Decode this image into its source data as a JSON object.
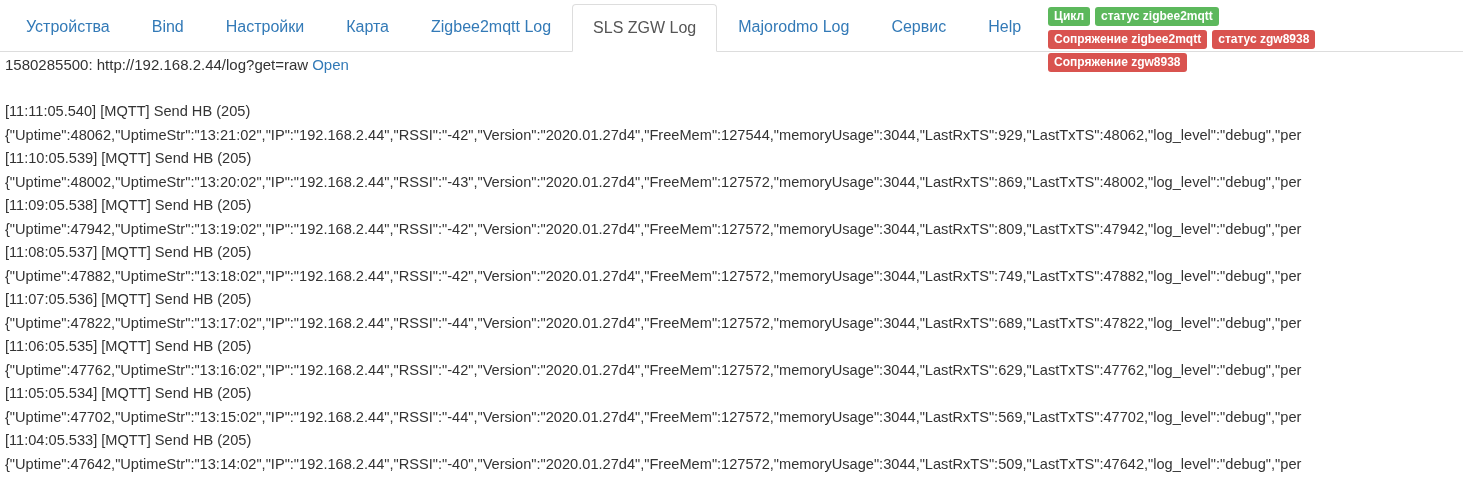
{
  "tabs": [
    {
      "label": "Устройства",
      "selected": false
    },
    {
      "label": "Bind",
      "selected": false
    },
    {
      "label": "Настройки",
      "selected": false
    },
    {
      "label": "Карта",
      "selected": false
    },
    {
      "label": "Zigbee2mqtt Log",
      "selected": false
    },
    {
      "label": "SLS ZGW Log",
      "selected": true
    },
    {
      "label": "Majorodmo Log",
      "selected": false
    },
    {
      "label": "Сервис",
      "selected": false
    },
    {
      "label": "Help",
      "selected": false
    }
  ],
  "status_badges": [
    {
      "label": "Цикл",
      "color": "#5cb85c"
    },
    {
      "label": "статус zigbee2mqtt",
      "color": "#5cb85c"
    },
    {
      "label": "Сопряжение zigbee2mqtt",
      "color": "#d9534f"
    },
    {
      "label": "статус zgw8938",
      "color": "#d9534f"
    },
    {
      "label": "Сопряжение zgw8938",
      "color": "#d9534f"
    }
  ],
  "source": {
    "text": "1580285500: http://192.168.2.44/log?get=raw",
    "link": "Open"
  },
  "log_lines": [
    "[11:11:05.540] [MQTT] Send HB (205)",
    "{\"Uptime\":48062,\"UptimeStr\":\"13:21:02\",\"IP\":\"192.168.2.44\",\"RSSI\":\"-42\",\"Version\":\"2020.01.27d4\",\"FreeMem\":127544,\"memoryUsage\":3044,\"LastRxTS\":929,\"LastTxTS\":48062,\"log_level\":\"debug\",\"per",
    "[11:10:05.539] [MQTT] Send HB (205)",
    "{\"Uptime\":48002,\"UptimeStr\":\"13:20:02\",\"IP\":\"192.168.2.44\",\"RSSI\":\"-43\",\"Version\":\"2020.01.27d4\",\"FreeMem\":127572,\"memoryUsage\":3044,\"LastRxTS\":869,\"LastTxTS\":48002,\"log_level\":\"debug\",\"per",
    "[11:09:05.538] [MQTT] Send HB (205)",
    "{\"Uptime\":47942,\"UptimeStr\":\"13:19:02\",\"IP\":\"192.168.2.44\",\"RSSI\":\"-42\",\"Version\":\"2020.01.27d4\",\"FreeMem\":127572,\"memoryUsage\":3044,\"LastRxTS\":809,\"LastTxTS\":47942,\"log_level\":\"debug\",\"per",
    "[11:08:05.537] [MQTT] Send HB (205)",
    "{\"Uptime\":47882,\"UptimeStr\":\"13:18:02\",\"IP\":\"192.168.2.44\",\"RSSI\":\"-42\",\"Version\":\"2020.01.27d4\",\"FreeMem\":127572,\"memoryUsage\":3044,\"LastRxTS\":749,\"LastTxTS\":47882,\"log_level\":\"debug\",\"per",
    "[11:07:05.536] [MQTT] Send HB (205)",
    "{\"Uptime\":47822,\"UptimeStr\":\"13:17:02\",\"IP\":\"192.168.2.44\",\"RSSI\":\"-44\",\"Version\":\"2020.01.27d4\",\"FreeMem\":127572,\"memoryUsage\":3044,\"LastRxTS\":689,\"LastTxTS\":47822,\"log_level\":\"debug\",\"per",
    "[11:06:05.535] [MQTT] Send HB (205)",
    "{\"Uptime\":47762,\"UptimeStr\":\"13:16:02\",\"IP\":\"192.168.2.44\",\"RSSI\":\"-42\",\"Version\":\"2020.01.27d4\",\"FreeMem\":127572,\"memoryUsage\":3044,\"LastRxTS\":629,\"LastTxTS\":47762,\"log_level\":\"debug\",\"per",
    "[11:05:05.534] [MQTT] Send HB (205)",
    "{\"Uptime\":47702,\"UptimeStr\":\"13:15:02\",\"IP\":\"192.168.2.44\",\"RSSI\":\"-44\",\"Version\":\"2020.01.27d4\",\"FreeMem\":127572,\"memoryUsage\":3044,\"LastRxTS\":569,\"LastTxTS\":47702,\"log_level\":\"debug\",\"per",
    "[11:04:05.533] [MQTT] Send HB (205)",
    "{\"Uptime\":47642,\"UptimeStr\":\"13:14:02\",\"IP\":\"192.168.2.44\",\"RSSI\":\"-40\",\"Version\":\"2020.01.27d4\",\"FreeMem\":127572,\"memoryUsage\":3044,\"LastRxTS\":509,\"LastTxTS\":47642,\"log_level\":\"debug\",\"per"
  ]
}
